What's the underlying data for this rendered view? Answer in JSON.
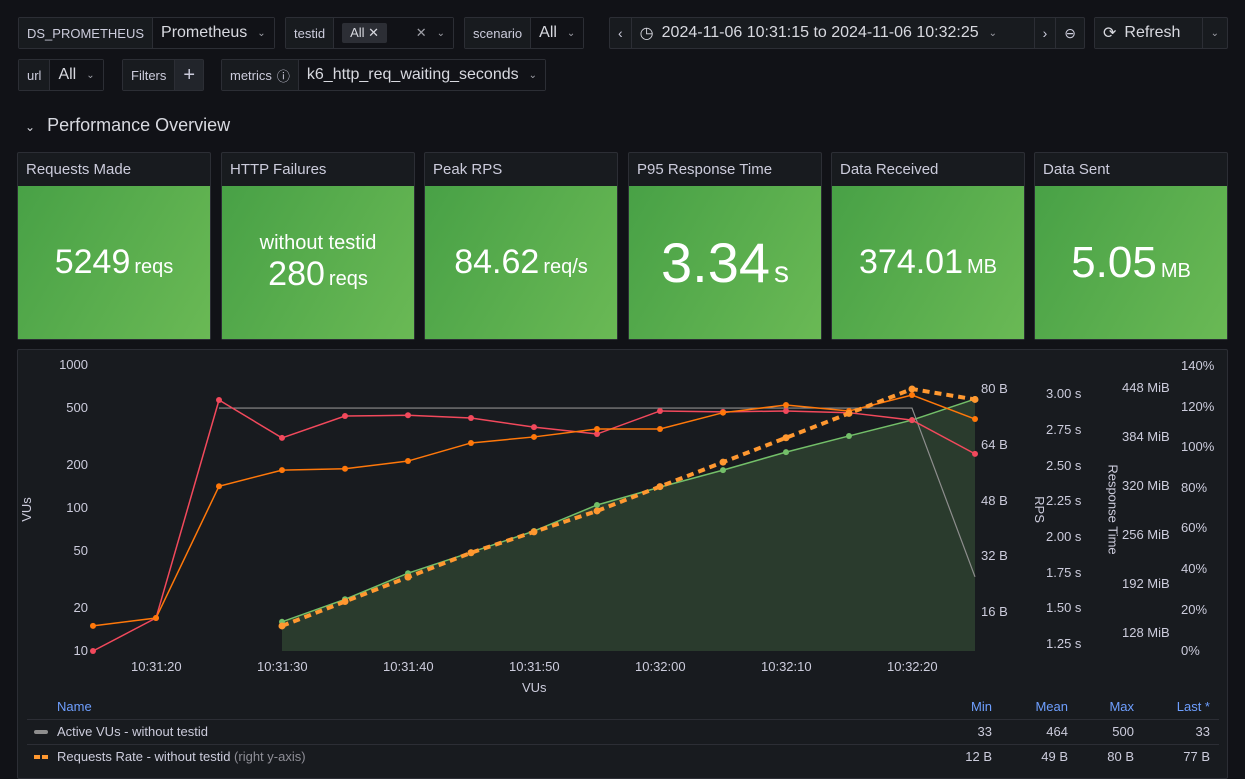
{
  "toolbar": {
    "datasource": {
      "label": "DS_PROMETHEUS",
      "value": "Prometheus"
    },
    "testid": {
      "label": "testid",
      "chip": "All"
    },
    "scenario": {
      "label": "scenario",
      "value": "All"
    },
    "time_range": "2024-11-06 10:31:15 to 2024-11-06 10:32:25",
    "refresh": "Refresh",
    "url": {
      "label": "url",
      "value": "All"
    },
    "filters": "Filters",
    "metrics": {
      "label": "metrics",
      "value": "k6_http_req_waiting_seconds"
    }
  },
  "row_title": "Performance Overview",
  "stats": [
    {
      "title": "Requests Made",
      "sub": "",
      "value": "5249",
      "unit": "reqs"
    },
    {
      "title": "HTTP Failures",
      "sub": "without testid",
      "value": "280",
      "unit": "reqs"
    },
    {
      "title": "Peak RPS",
      "sub": "",
      "value": "84.62",
      "unit": "req/s"
    },
    {
      "title": "P95 Response Time",
      "sub": "",
      "value": "3.34",
      "unit": "s"
    },
    {
      "title": "Data Received",
      "sub": "",
      "value": "374.01",
      "unit": "MB"
    },
    {
      "title": "Data Sent",
      "sub": "",
      "value": "5.05",
      "unit": "MB"
    }
  ],
  "colors": {
    "green": "#73bf69",
    "red": "#f2495c",
    "orange": "#ff780a",
    "dashed": "#ff9830",
    "grey": "#8e8e8e",
    "stat_bg": "#56a64b"
  },
  "chart_data": {
    "type": "line",
    "xlabel": "VUs",
    "x": [
      "10:31:15",
      "10:31:20",
      "10:31:25",
      "10:31:30",
      "10:31:35",
      "10:31:40",
      "10:31:45",
      "10:31:50",
      "10:31:55",
      "10:32:00",
      "10:32:05",
      "10:32:10",
      "10:32:15",
      "10:32:20",
      "10:32:25"
    ],
    "x_ticks": [
      "10:31:20",
      "10:31:30",
      "10:31:40",
      "10:31:50",
      "10:32:00",
      "10:32:10",
      "10:32:20"
    ],
    "axes": {
      "left": {
        "label": "VUs",
        "scale": "log",
        "ticks": [
          "1000",
          "500",
          "200",
          "100",
          "50",
          "20",
          "10"
        ],
        "range": [
          10,
          1000
        ]
      },
      "rps": {
        "label": "RPS",
        "ticks": [
          "80 B",
          "64 B",
          "48 B",
          "32 B",
          "16 B"
        ]
      },
      "resp": {
        "label": "Response Time",
        "ticks": [
          "3.00 s",
          "2.75 s",
          "2.50 s",
          "2.25 s",
          "2.00 s",
          "1.75 s",
          "1.50 s",
          "1.25 s"
        ]
      },
      "mib": {
        "ticks": [
          "448 MiB",
          "384 MiB",
          "320 MiB",
          "256 MiB",
          "192 MiB",
          "128 MiB"
        ]
      },
      "pct": {
        "ticks": [
          "140%",
          "120%",
          "100%",
          "80%",
          "60%",
          "40%",
          "20%",
          "0%"
        ]
      }
    },
    "series": [
      {
        "name": "Active VUs - without testid",
        "axis": "left",
        "color": "#8e8e8e",
        "values": [
          null,
          null,
          500,
          500,
          500,
          500,
          500,
          500,
          500,
          500,
          500,
          500,
          500,
          500,
          33
        ]
      },
      {
        "name": "Requests Rate - without testid",
        "axis": "rps",
        "unit": "B",
        "color": "#ff9830",
        "dashed": true,
        "values": [
          null,
          null,
          null,
          12,
          19,
          26,
          33,
          39,
          45,
          52,
          59,
          66,
          73,
          80,
          77
        ]
      },
      {
        "axis": "left",
        "color": "#f2495c",
        "values": [
          10,
          17,
          569,
          309,
          440,
          445,
          426,
          368,
          329,
          477,
          470,
          477,
          464,
          412,
          239
        ]
      },
      {
        "axis": "left",
        "color": "#ff780a",
        "values": [
          15,
          17,
          142,
          184,
          188,
          213,
          285,
          314,
          357,
          357,
          464,
          525,
          477,
          617,
          419
        ]
      },
      {
        "axis": "left",
        "color": "#73bf69",
        "fill": true,
        "values": [
          null,
          null,
          null,
          16,
          23,
          35,
          49,
          69,
          105,
          140,
          184,
          246,
          319,
          412,
          578
        ]
      }
    ]
  },
  "legend": {
    "headers": [
      "Name",
      "Min",
      "Mean",
      "Max",
      "Last *"
    ],
    "rows": [
      {
        "name": "Active VUs - without testid",
        "suffix": "",
        "min": "33",
        "mean": "464",
        "max": "500",
        "last": "33"
      },
      {
        "name": "Requests Rate - without testid",
        "suffix": "(right y-axis)",
        "min": "12 B",
        "mean": "49 B",
        "max": "80 B",
        "last": "77 B"
      }
    ]
  }
}
